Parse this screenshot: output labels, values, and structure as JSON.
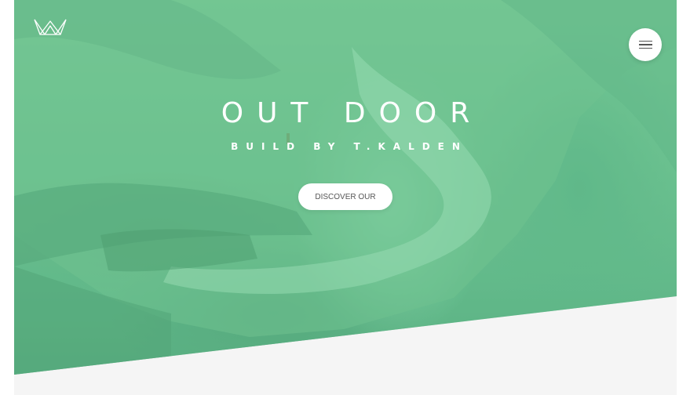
{
  "header": {
    "logo_icon": "crown-logo-icon",
    "menu_icon": "hamburger-menu-icon"
  },
  "hero": {
    "title": "OUT DOOR",
    "subtitle": "BUILD BY T.KALDEN",
    "cta_label": "DISCOVER OUR"
  },
  "colors": {
    "hero_tint": "#6cc091",
    "footer_background": "#f5f5f5",
    "button_background": "#ffffff",
    "button_text": "#555555"
  }
}
